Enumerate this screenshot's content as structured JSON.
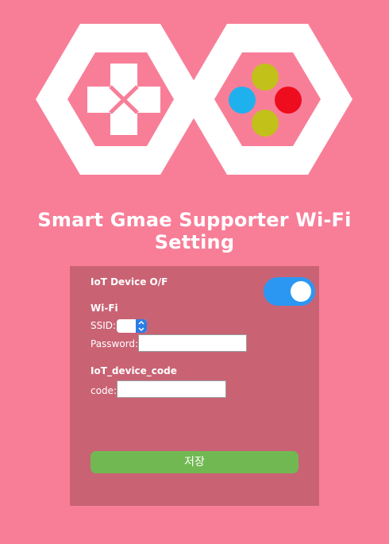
{
  "colors": {
    "background": "#f87e98",
    "panel": "#c96374",
    "toggle_on": "#2b97f2",
    "save_button": "#72b852",
    "logo_shape": "#ffffff",
    "button_yellow": "#c2c11a",
    "button_blue": "#1fb1ee",
    "button_red": "#ee0d1f"
  },
  "header": {
    "title": "Smart Gmae Supporter Wi-Fi Setting",
    "logo": {
      "left_icon": "dpad-icon",
      "right_icon": "action-buttons-icon"
    }
  },
  "form": {
    "iot_toggle": {
      "label": "IoT Device O/F",
      "state": "on"
    },
    "wifi": {
      "section_label": "Wi-Fi",
      "ssid_label": "SSID:",
      "ssid_value": "",
      "password_label": "Password:",
      "password_value": ""
    },
    "device": {
      "section_label": "IoT_device_code",
      "code_label": "code:",
      "code_value": ""
    },
    "save_label": "저장"
  }
}
